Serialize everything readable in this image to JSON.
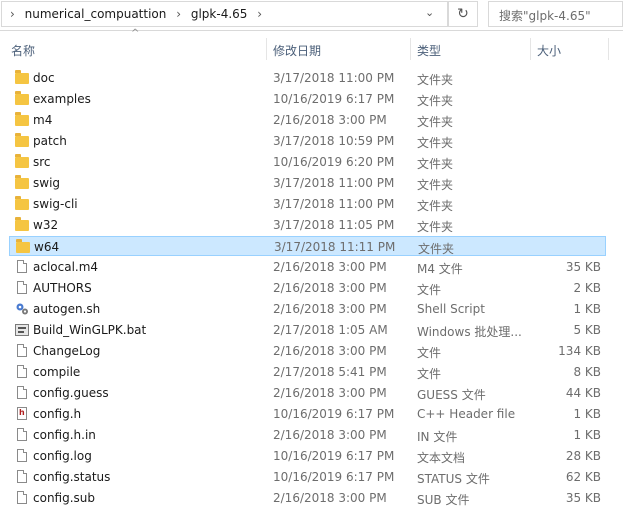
{
  "address": {
    "path": [
      "numerical_compuattion",
      "glpk-4.65"
    ],
    "separator": "›",
    "dropdown": "⌄",
    "refresh": "↻"
  },
  "search": {
    "placeholder": "搜索\"glpk-4.65\""
  },
  "columns": {
    "name": "名称",
    "date": "修改日期",
    "type": "类型",
    "size": "大小",
    "sort_arrow": "^"
  },
  "files": [
    {
      "name": "doc",
      "date": "3/17/2018 11:00 PM",
      "type": "文件夹",
      "size": "",
      "icon": "folder-icon"
    },
    {
      "name": "examples",
      "date": "10/16/2019 6:17 PM",
      "type": "文件夹",
      "size": "",
      "icon": "folder-icon"
    },
    {
      "name": "m4",
      "date": "2/16/2018 3:00 PM",
      "type": "文件夹",
      "size": "",
      "icon": "folder-icon"
    },
    {
      "name": "patch",
      "date": "3/17/2018 10:59 PM",
      "type": "文件夹",
      "size": "",
      "icon": "folder-icon"
    },
    {
      "name": "src",
      "date": "10/16/2019 6:20 PM",
      "type": "文件夹",
      "size": "",
      "icon": "folder-icon"
    },
    {
      "name": "swig",
      "date": "3/17/2018 11:00 PM",
      "type": "文件夹",
      "size": "",
      "icon": "folder-icon"
    },
    {
      "name": "swig-cli",
      "date": "3/17/2018 11:00 PM",
      "type": "文件夹",
      "size": "",
      "icon": "folder-icon"
    },
    {
      "name": "w32",
      "date": "3/17/2018 11:05 PM",
      "type": "文件夹",
      "size": "",
      "icon": "folder-icon"
    },
    {
      "name": "w64",
      "date": "3/17/2018 11:11 PM",
      "type": "文件夹",
      "size": "",
      "icon": "folder-icon",
      "selected": true
    },
    {
      "name": "aclocal.m4",
      "date": "2/16/2018 3:00 PM",
      "type": "M4 文件",
      "size": "35 KB",
      "icon": "file-icon"
    },
    {
      "name": "AUTHORS",
      "date": "2/16/2018 3:00 PM",
      "type": "文件",
      "size": "2 KB",
      "icon": "file-icon"
    },
    {
      "name": "autogen.sh",
      "date": "2/16/2018 3:00 PM",
      "type": "Shell Script",
      "size": "1 KB",
      "icon": "shell-script-icon"
    },
    {
      "name": "Build_WinGLPK.bat",
      "date": "2/17/2018 1:05 AM",
      "type": "Windows 批处理...",
      "size": "5 KB",
      "icon": "batch-file-icon"
    },
    {
      "name": "ChangeLog",
      "date": "2/16/2018 3:00 PM",
      "type": "文件",
      "size": "134 KB",
      "icon": "file-icon"
    },
    {
      "name": "compile",
      "date": "2/17/2018 5:41 PM",
      "type": "文件",
      "size": "8 KB",
      "icon": "file-icon"
    },
    {
      "name": "config.guess",
      "date": "2/16/2018 3:00 PM",
      "type": "GUESS 文件",
      "size": "44 KB",
      "icon": "file-icon"
    },
    {
      "name": "config.h",
      "date": "10/16/2019 6:17 PM",
      "type": "C++ Header file",
      "size": "1 KB",
      "icon": "header-file-icon"
    },
    {
      "name": "config.h.in",
      "date": "2/16/2018 3:00 PM",
      "type": "IN 文件",
      "size": "1 KB",
      "icon": "file-icon"
    },
    {
      "name": "config.log",
      "date": "10/16/2019 6:17 PM",
      "type": "文本文档",
      "size": "28 KB",
      "icon": "file-icon"
    },
    {
      "name": "config.status",
      "date": "10/16/2019 6:17 PM",
      "type": "STATUS 文件",
      "size": "62 KB",
      "icon": "file-icon"
    },
    {
      "name": "config.sub",
      "date": "2/16/2018 3:00 PM",
      "type": "SUB 文件",
      "size": "35 KB",
      "icon": "file-icon"
    }
  ],
  "colors": {
    "selection_bg": "#cce8ff",
    "selection_border": "#99d1ff",
    "folder": "#f5c542",
    "header_text": "#4c607a"
  }
}
